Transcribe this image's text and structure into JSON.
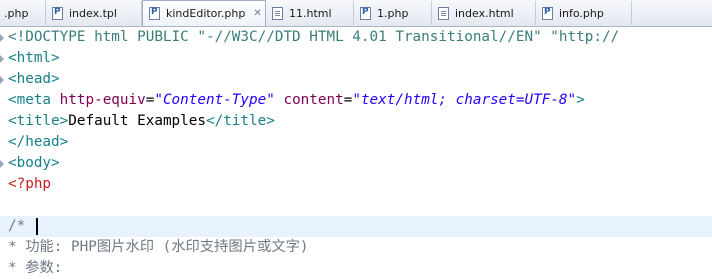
{
  "tabs": [
    {
      "label": ".php",
      "icon": "php-file-icon",
      "active": false
    },
    {
      "label": "index.tpl",
      "icon": "php-file-icon",
      "active": false
    },
    {
      "label": "kindEditor.php",
      "icon": "php-file-icon",
      "active": true,
      "close": "✕"
    },
    {
      "label": "11.html",
      "icon": "html-file-icon",
      "active": false
    },
    {
      "label": "1.php",
      "icon": "php-file-icon",
      "active": false
    },
    {
      "label": "index.html",
      "icon": "html-file-icon",
      "active": false
    },
    {
      "label": "info.php",
      "icon": "php-file-icon",
      "active": false
    }
  ],
  "code": {
    "l1": {
      "a": "<!DOCTYPE html PUBLIC ",
      "b": "\"-//W3C//DTD HTML 4.01 Transitional//EN\"",
      "c": " \"http://"
    },
    "l2": "<html>",
    "l3": "<head>",
    "l4": {
      "open": "<meta ",
      "attr1": "http-equiv",
      "eq1": "=",
      "val1": "\"Content-Type\"",
      "sp": " ",
      "attr2": "content",
      "eq2": "=",
      "val2": "\"text/html; charset=UTF-8\"",
      "close": ">"
    },
    "l5": {
      "open": "<title>",
      "text": "Default Examples",
      "close": "</title>"
    },
    "l6": "</head>",
    "l7": "<body>",
    "l8": "<?php",
    "l9": "",
    "l10": "/*",
    "l11": "* 功能: PHP图片水印 (水印支持图片或文字)",
    "l12": "* 参数:"
  }
}
